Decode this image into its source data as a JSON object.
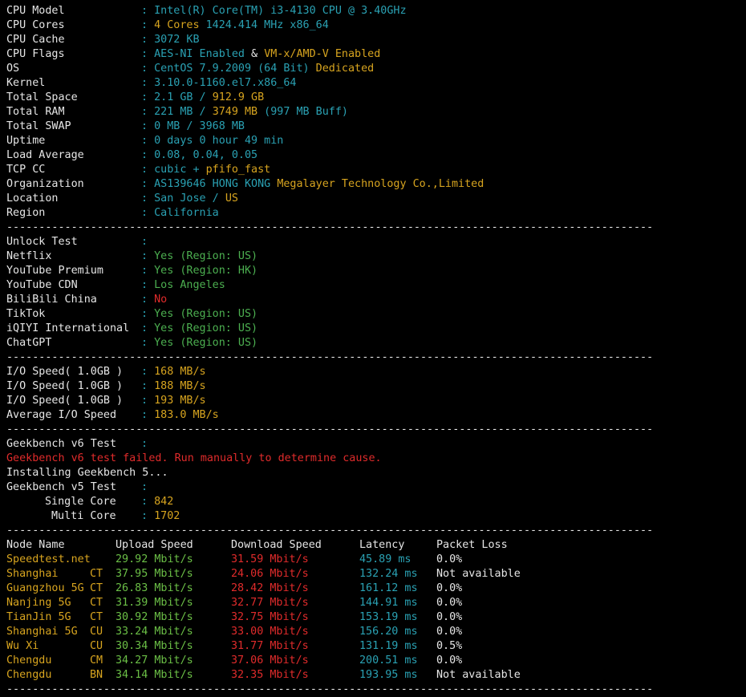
{
  "colors": {
    "white": "#e6e6e6",
    "cyan": "#2aa1b3",
    "yellow": "#d7a41f",
    "green": "#4caf50",
    "red": "#e02b2b",
    "background": "#000000"
  },
  "separator": "----------------------------------------------------------------------------------------------------",
  "sysinfo": [
    {
      "label": "CPU Model",
      "parts": [
        {
          "t": "Intel(R) Core(TM) i3-4130 CPU @ 3.40GHz",
          "c": "c"
        }
      ]
    },
    {
      "label": "CPU Cores",
      "parts": [
        {
          "t": "4 Cores ",
          "c": "y"
        },
        {
          "t": "1424.414 MHz x86_64",
          "c": "c"
        }
      ]
    },
    {
      "label": "CPU Cache",
      "parts": [
        {
          "t": "3072 KB",
          "c": "c"
        }
      ]
    },
    {
      "label": "CPU Flags",
      "parts": [
        {
          "t": "AES-NI Enabled",
          "c": "c"
        },
        {
          "t": " & ",
          "c": "w"
        },
        {
          "t": "VM-x/AMD-V Enabled",
          "c": "y"
        }
      ]
    },
    {
      "label": "OS",
      "parts": [
        {
          "t": "CentOS 7.9.2009 (64 Bit) ",
          "c": "c"
        },
        {
          "t": "Dedicated",
          "c": "y"
        }
      ]
    },
    {
      "label": "Kernel",
      "parts": [
        {
          "t": "3.10.0-1160.el7.x86_64",
          "c": "c"
        }
      ]
    },
    {
      "label": "Total Space",
      "parts": [
        {
          "t": "2.1 GB / ",
          "c": "c"
        },
        {
          "t": "912.9 GB",
          "c": "y"
        }
      ]
    },
    {
      "label": "Total RAM",
      "parts": [
        {
          "t": "221 MB / ",
          "c": "c"
        },
        {
          "t": "3749 MB",
          "c": "y"
        },
        {
          "t": " (997 MB Buff)",
          "c": "c"
        }
      ]
    },
    {
      "label": "Total SWAP",
      "parts": [
        {
          "t": "0 MB / 3968 MB",
          "c": "c"
        }
      ]
    },
    {
      "label": "Uptime",
      "parts": [
        {
          "t": "0 days 0 hour 49 min",
          "c": "c"
        }
      ]
    },
    {
      "label": "Load Average",
      "parts": [
        {
          "t": "0.08, 0.04, 0.05",
          "c": "c"
        }
      ]
    },
    {
      "label": "TCP CC",
      "parts": [
        {
          "t": "cubic + ",
          "c": "c"
        },
        {
          "t": "pfifo_fast",
          "c": "y"
        }
      ]
    },
    {
      "label": "Organization",
      "parts": [
        {
          "t": "AS139646 HONG KONG ",
          "c": "c"
        },
        {
          "t": "Megalayer Technology Co.,Limited",
          "c": "y"
        }
      ]
    },
    {
      "label": "Location",
      "parts": [
        {
          "t": "San Jose / ",
          "c": "c"
        },
        {
          "t": "US",
          "c": "y"
        }
      ]
    },
    {
      "label": "Region",
      "parts": [
        {
          "t": "California",
          "c": "c"
        }
      ]
    }
  ],
  "unlock": [
    {
      "label": "Unlock Test",
      "parts": []
    },
    {
      "label": "Netflix",
      "parts": [
        {
          "t": "Yes (Region: US)",
          "c": "g"
        }
      ]
    },
    {
      "label": "YouTube Premium",
      "parts": [
        {
          "t": "Yes (Region: HK)",
          "c": "g"
        }
      ]
    },
    {
      "label": "YouTube CDN",
      "parts": [
        {
          "t": "Los Angeles",
          "c": "g"
        }
      ]
    },
    {
      "label": "BiliBili China",
      "parts": [
        {
          "t": "No",
          "c": "r"
        }
      ]
    },
    {
      "label": "TikTok",
      "parts": [
        {
          "t": "Yes (Region: US)",
          "c": "g"
        }
      ]
    },
    {
      "label": "iQIYI International",
      "parts": [
        {
          "t": "Yes (Region: US)",
          "c": "g"
        }
      ]
    },
    {
      "label": "ChatGPT",
      "parts": [
        {
          "t": "Yes (Region: US)",
          "c": "g"
        }
      ]
    }
  ],
  "io": [
    {
      "label": "I/O Speed( 1.0GB )",
      "parts": [
        {
          "t": "168 MB/s",
          "c": "y"
        }
      ]
    },
    {
      "label": "I/O Speed( 1.0GB )",
      "parts": [
        {
          "t": "188 MB/s",
          "c": "y"
        }
      ]
    },
    {
      "label": "I/O Speed( 1.0GB )",
      "parts": [
        {
          "t": "193 MB/s",
          "c": "y"
        }
      ]
    },
    {
      "label": "Average I/O Speed",
      "parts": [
        {
          "t": "183.0 MB/s",
          "c": "y"
        }
      ]
    }
  ],
  "geekbench": {
    "v6_label": "Geekbench v6 Test",
    "v6_error": "Geekbench v6 test failed. Run manually to determine cause.",
    "installing": "Installing Geekbench 5...",
    "v5_label": "Geekbench v5 Test",
    "single_label": "Single Core",
    "single_value": "842",
    "multi_label": "Multi Core",
    "multi_value": "1702"
  },
  "speedtest": {
    "headers": [
      "Node Name",
      "Upload Speed",
      "Download Speed",
      "Latency",
      "Packet Loss"
    ],
    "rows": [
      {
        "node": "Speedtest.net",
        "isp": "",
        "upload": "29.92 Mbit/s",
        "download": "31.59 Mbit/s",
        "latency": "45.89 ms",
        "loss": "0.0%"
      },
      {
        "node": "Shanghai",
        "isp": "CT",
        "upload": "37.95 Mbit/s",
        "download": "24.06 Mbit/s",
        "latency": "132.24 ms",
        "loss": "Not available"
      },
      {
        "node": "Guangzhou 5G",
        "isp": "CT",
        "upload": "26.83 Mbit/s",
        "download": "28.42 Mbit/s",
        "latency": "161.12 ms",
        "loss": "0.0%"
      },
      {
        "node": "Nanjing 5G",
        "isp": "CT",
        "upload": "31.39 Mbit/s",
        "download": "32.77 Mbit/s",
        "latency": "144.91 ms",
        "loss": "0.0%"
      },
      {
        "node": "TianJin 5G",
        "isp": "CT",
        "upload": "30.92 Mbit/s",
        "download": "32.75 Mbit/s",
        "latency": "153.19 ms",
        "loss": "0.0%"
      },
      {
        "node": "Shanghai 5G",
        "isp": "CU",
        "upload": "33.24 Mbit/s",
        "download": "33.00 Mbit/s",
        "latency": "156.20 ms",
        "loss": "0.0%"
      },
      {
        "node": "Wu Xi",
        "isp": "CU",
        "upload": "30.34 Mbit/s",
        "download": "31.77 Mbit/s",
        "latency": "131.19 ms",
        "loss": "0.5%"
      },
      {
        "node": "Chengdu",
        "isp": "CM",
        "upload": "34.27 Mbit/s",
        "download": "37.06 Mbit/s",
        "latency": "200.51 ms",
        "loss": "0.0%"
      },
      {
        "node": "Chengdu",
        "isp": "BN",
        "upload": "34.14 Mbit/s",
        "download": "32.35 Mbit/s",
        "latency": "193.95 ms",
        "loss": "Not available"
      }
    ]
  }
}
